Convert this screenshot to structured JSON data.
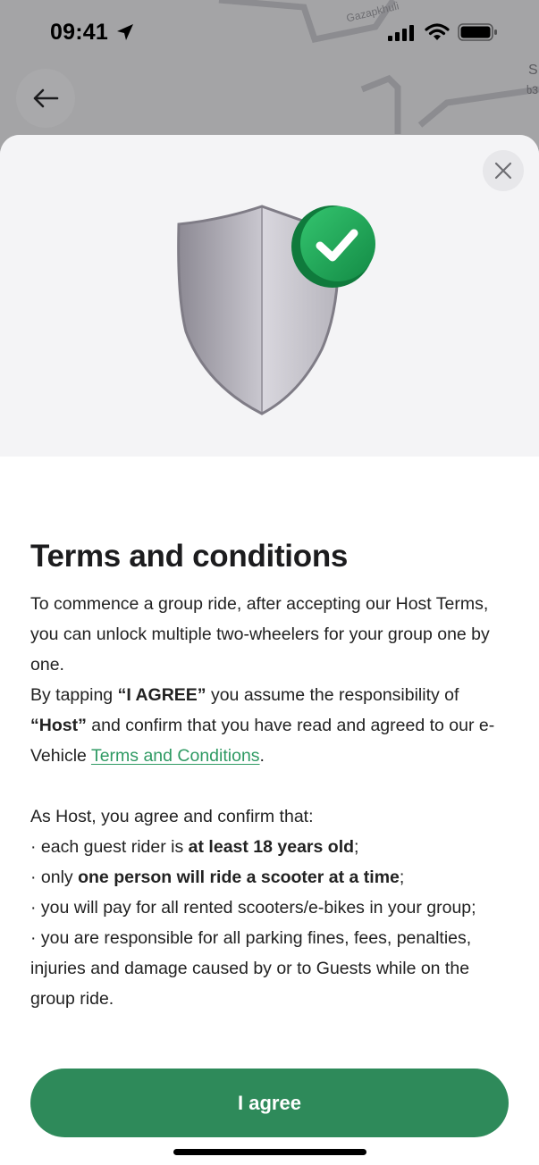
{
  "status_bar": {
    "time": "09:41"
  },
  "map": {
    "street_label": "Gazapkhuli",
    "edge_label_1": "S",
    "edge_label_2": "ხ3"
  },
  "icons": {
    "back": "arrow-left-icon",
    "close": "close-icon",
    "location": "location-arrow-icon",
    "signal": "cellular-signal-icon",
    "wifi": "wifi-icon",
    "battery": "battery-icon",
    "illustration": "shield-check-icon"
  },
  "colors": {
    "accent_green": "#2e8a5a",
    "link_green": "#2f9a63",
    "badge_green": "#1f9a55"
  },
  "sheet": {
    "title": "Terms and conditions",
    "intro_1": "To commence a group ride, after accepting our Host Terms, you can unlock multiple two-wheelers for your group one by one.",
    "intro_2_pre": "By tapping ",
    "intro_2_agree": "“I AGREE”",
    "intro_2_mid": " you assume the responsibility of ",
    "intro_2_host": "“Host”",
    "intro_2_post": " and confirm that you have read and agreed to our e-Vehicle ",
    "terms_link": "Terms and Conditions",
    "intro_2_end": ".",
    "host_heading": "As Host, you agree and confirm that:",
    "bullet_1_pre": "· each guest rider is ",
    "bullet_1_bold": "at least 18 years old",
    "bullet_1_end": ";",
    "bullet_2_pre": "· only ",
    "bullet_2_bold": "one person will ride a scooter at a time",
    "bullet_2_end": ";",
    "bullet_3": "· you will pay for all rented scooters/e-bikes in your group;",
    "bullet_4": "· you are responsible for all parking fines, fees, penalties, injuries and damage caused by or to Guests while on the group ride.",
    "agree_label": "I agree"
  }
}
